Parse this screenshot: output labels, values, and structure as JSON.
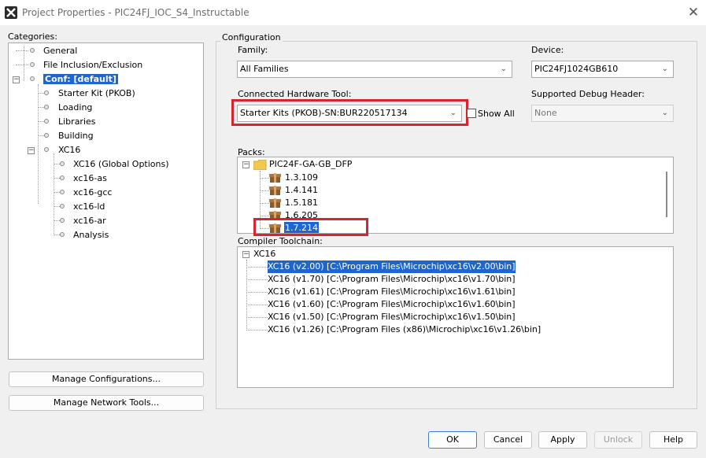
{
  "window": {
    "title": "Project Properties - PIC24FJ_IOC_S4_Instructable",
    "close_glyph": "✕"
  },
  "categories": {
    "label": "Categories:",
    "items": [
      {
        "label": "General"
      },
      {
        "label": "File Inclusion/Exclusion"
      },
      {
        "label": "Conf: [default]",
        "selected": true
      },
      {
        "label": "Starter Kit (PKOB)"
      },
      {
        "label": "Loading"
      },
      {
        "label": "Libraries"
      },
      {
        "label": "Building"
      },
      {
        "label": "XC16"
      },
      {
        "label": "XC16 (Global Options)"
      },
      {
        "label": "xc16-as"
      },
      {
        "label": "xc16-gcc"
      },
      {
        "label": "xc16-ld"
      },
      {
        "label": "xc16-ar"
      },
      {
        "label": "Analysis"
      }
    ]
  },
  "left_buttons": {
    "manage_configurations": "Manage Configurations...",
    "manage_network_tools": "Manage Network Tools..."
  },
  "configuration": {
    "group_label": "Configuration",
    "family": {
      "label": "Family:",
      "value": "All Families"
    },
    "device": {
      "label": "Device:",
      "value": "PIC24FJ1024GB610"
    },
    "hardware_tool": {
      "label": "Connected Hardware Tool:",
      "value": "Starter Kits (PKOB)-SN:BUR220517134"
    },
    "show_all": {
      "label": "Show All",
      "checked": false
    },
    "debug_header": {
      "label": "Supported Debug Header:",
      "value": "None"
    },
    "packs": {
      "label": "Packs:",
      "root": "PIC24F-GA-GB_DFP",
      "versions": [
        "1.3.109",
        "1.4.141",
        "1.5.181",
        "1.6.205",
        "1.7.214"
      ],
      "selected": "1.7.214"
    },
    "toolchain": {
      "label": "Compiler Toolchain:",
      "root": "XC16",
      "items": [
        "XC16 (v2.00) [C:\\Program Files\\Microchip\\xc16\\v2.00\\bin]",
        "XC16 (v1.70) [C:\\Program Files\\Microchip\\xc16\\v1.70\\bin]",
        "XC16 (v1.61) [C:\\Program Files\\Microchip\\xc16\\v1.61\\bin]",
        "XC16 (v1.60) [C:\\Program Files\\Microchip\\xc16\\v1.60\\bin]",
        "XC16 (v1.50) [C:\\Program Files\\Microchip\\xc16\\v1.50\\bin]",
        "XC16 (v1.26) [C:\\Program Files (x86)\\Microchip\\xc16\\v1.26\\bin]"
      ]
    }
  },
  "footer": {
    "ok": "OK",
    "cancel": "Cancel",
    "apply": "Apply",
    "unlock": "Unlock",
    "help": "Help"
  },
  "colors": {
    "selection": "#1e66cc",
    "annotation_red": "#d7242f"
  },
  "icons": {
    "chevron": "chevron-down-icon",
    "package": "package-icon",
    "folder": "folder-icon"
  }
}
